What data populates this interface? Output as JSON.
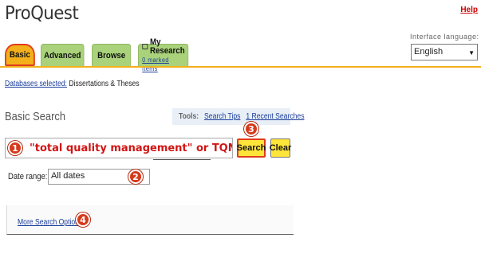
{
  "header": {
    "logo": "ProQuest",
    "help_label": "Help"
  },
  "tabs": [
    {
      "label": "Basic",
      "active": true
    },
    {
      "label": "Advanced"
    },
    {
      "label": "Browse"
    },
    {
      "label": "My Research",
      "sublabel": "0 marked items"
    }
  ],
  "language": {
    "label": "Interface language:",
    "value": "English"
  },
  "databases": {
    "link_label": "Databases selected:",
    "value": "Dissertations & Theses"
  },
  "basic_search": {
    "title": "Basic Search"
  },
  "tools": {
    "label": "Tools:",
    "search_tips": "Search Tips",
    "recent_searches": "1 Recent Searches"
  },
  "search": {
    "query": "\"total quality management\" or TQM",
    "search_button": "Search",
    "clear_button": "Clear"
  },
  "date_range": {
    "label": "Date range:",
    "value": "All dates"
  },
  "more_options": {
    "label": "More Search Options"
  },
  "callouts": [
    "1",
    "2",
    "3",
    "4"
  ],
  "colors": {
    "tab_green": "#a9d27a",
    "tab_active": "#f3b01b",
    "button_yellow": "#ffe53a",
    "callout_red": "#d63a1c",
    "link_blue": "#1a3c9a"
  }
}
